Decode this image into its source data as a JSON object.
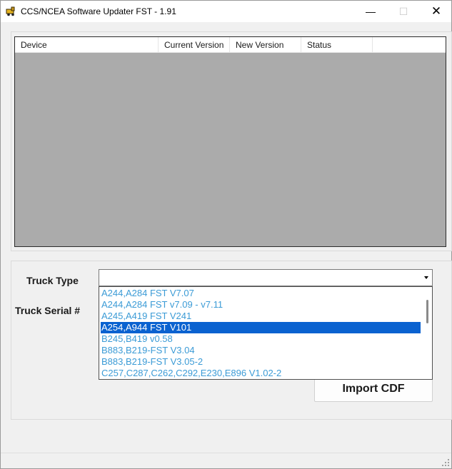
{
  "window": {
    "title": "CCS/NCEA Software Updater FST - 1.91",
    "controls": {
      "minimize": "—",
      "maximize": "☐",
      "close": "✕"
    }
  },
  "device_list": {
    "columns": [
      "Device",
      "Current Version",
      "New Version",
      "Status"
    ]
  },
  "form": {
    "truck_type_label": "Truck Type",
    "truck_serial_label": "Truck Serial #",
    "import_button": "Import CDF"
  },
  "truck_type_dropdown": {
    "selected_index": 3,
    "options": [
      "A244,A284 FST V7.07",
      "A244,A284 FST v7.09 - v7.11",
      "A245,A419 FST V241",
      "A254,A944 FST V101",
      "B245,B419 v0.58",
      "B883,B219-FST V3.04",
      "B883,B219-FST V3.05-2",
      "C257,C287,C262,C292,E230,E896 V1.02-2"
    ]
  },
  "colors": {
    "list_background": "#ababab",
    "option_text": "#3b9bd6",
    "selection": "#0a62d0"
  }
}
